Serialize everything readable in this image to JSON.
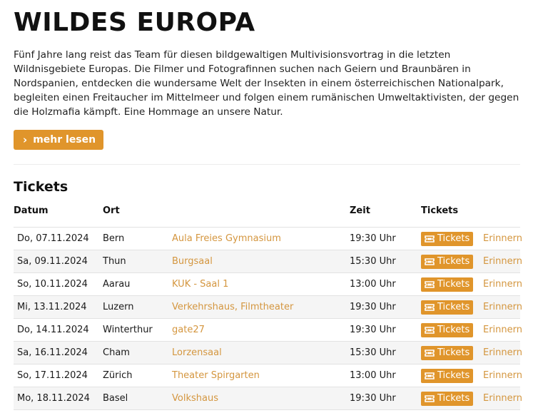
{
  "event": {
    "title": "WILDES EUROPA",
    "description": "Fünf Jahre lang reist das Team für diesen bildgewaltigen Multivisionsvortrag in die letzten Wildnisgebiete Europas. Die Filmer und Fotografinnen suchen nach Geiern und Braunbären in Nordspanien, entdecken die wundersame Welt der Insekten in einem österreichischen Nationalpark, begleiten einen Freitaucher im Mittelmeer und folgen einem rumänischen Umweltaktivisten, der gegen die Holzmafia kämpft. Eine Hommage an unsere Natur.",
    "more_label": "mehr lesen"
  },
  "tickets": {
    "heading": "Tickets",
    "columns": {
      "date": "Datum",
      "place": "Ort",
      "venue": "",
      "time": "Zeit",
      "tickets": "Tickets",
      "remind": ""
    },
    "ticket_button_label": "Tickets",
    "remind_label": "Erinnern",
    "rows": [
      {
        "date": "Do, 07.11.2024",
        "place": "Bern",
        "venue": "Aula Freies Gymnasium",
        "time": "19:30 Uhr"
      },
      {
        "date": "Sa, 09.11.2024",
        "place": "Thun",
        "venue": "Burgsaal",
        "time": "15:30 Uhr"
      },
      {
        "date": "So, 10.11.2024",
        "place": "Aarau",
        "venue": "KUK - Saal 1",
        "time": "13:00 Uhr"
      },
      {
        "date": "Mi, 13.11.2024",
        "place": "Luzern",
        "venue": "Verkehrshaus, Filmtheater",
        "time": "19:30 Uhr"
      },
      {
        "date": "Do, 14.11.2024",
        "place": "Winterthur",
        "venue": "gate27",
        "time": "19:30 Uhr"
      },
      {
        "date": "Sa, 16.11.2024",
        "place": "Cham",
        "venue": "Lorzensaal",
        "time": "15:30 Uhr"
      },
      {
        "date": "So, 17.11.2024",
        "place": "Zürich",
        "venue": "Theater Spirgarten",
        "time": "13:00 Uhr"
      },
      {
        "date": "Mo, 18.11.2024",
        "place": "Basel",
        "venue": "Volkshaus",
        "time": "19:30 Uhr"
      }
    ]
  },
  "colors": {
    "accent": "#e0952b",
    "link": "#d4963f"
  }
}
